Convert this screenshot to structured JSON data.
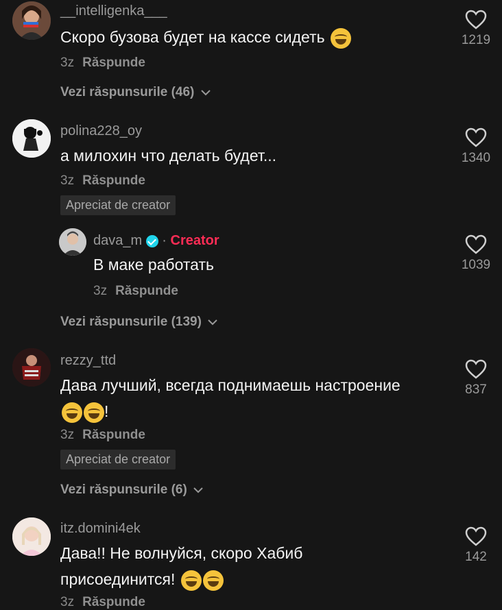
{
  "comments": [
    {
      "username": "__intelligenka___",
      "text": "Скоро бузова будет на кассе сидеть",
      "time": "3z",
      "reply_label": "Răspunde",
      "likes": "1219",
      "view_replies": "Vezi răspunsurile (46)"
    },
    {
      "username": "polina228_oy",
      "text": "а милохин что делать будет...",
      "time": "3z",
      "reply_label": "Răspunde",
      "likes": "1340",
      "badge": "Apreciat de creator"
    },
    {
      "username": "dava_m",
      "creator_label": "Creator",
      "separator": "·",
      "text": "В маке работать",
      "time": "3z",
      "reply_label": "Răspunde",
      "likes": "1039",
      "view_replies": "Vezi răspunsurile (139)"
    },
    {
      "username": "rezzy_ttd",
      "text": "Дава лучший, всегда поднимаешь настроение",
      "text_suffix": "!",
      "time": "3z",
      "reply_label": "Răspunde",
      "likes": "837",
      "badge": "Apreciat de creator",
      "view_replies": "Vezi răspunsurile (6)"
    },
    {
      "username": "itz.domini4ek",
      "text": "Дава!! Не волнуйся, скоро Хабиб присоединится!",
      "time": "3z",
      "reply_label": "Răspunde",
      "likes": "142"
    }
  ],
  "icons": {
    "like": "heart-outline-icon",
    "expand": "chevron-down-icon",
    "verified": "verified-badge-icon",
    "emoji": "tears-of-joy-emoji"
  },
  "colors": {
    "background": "#161616",
    "creator": "#fe2c55",
    "verified": "#20d5ec"
  }
}
